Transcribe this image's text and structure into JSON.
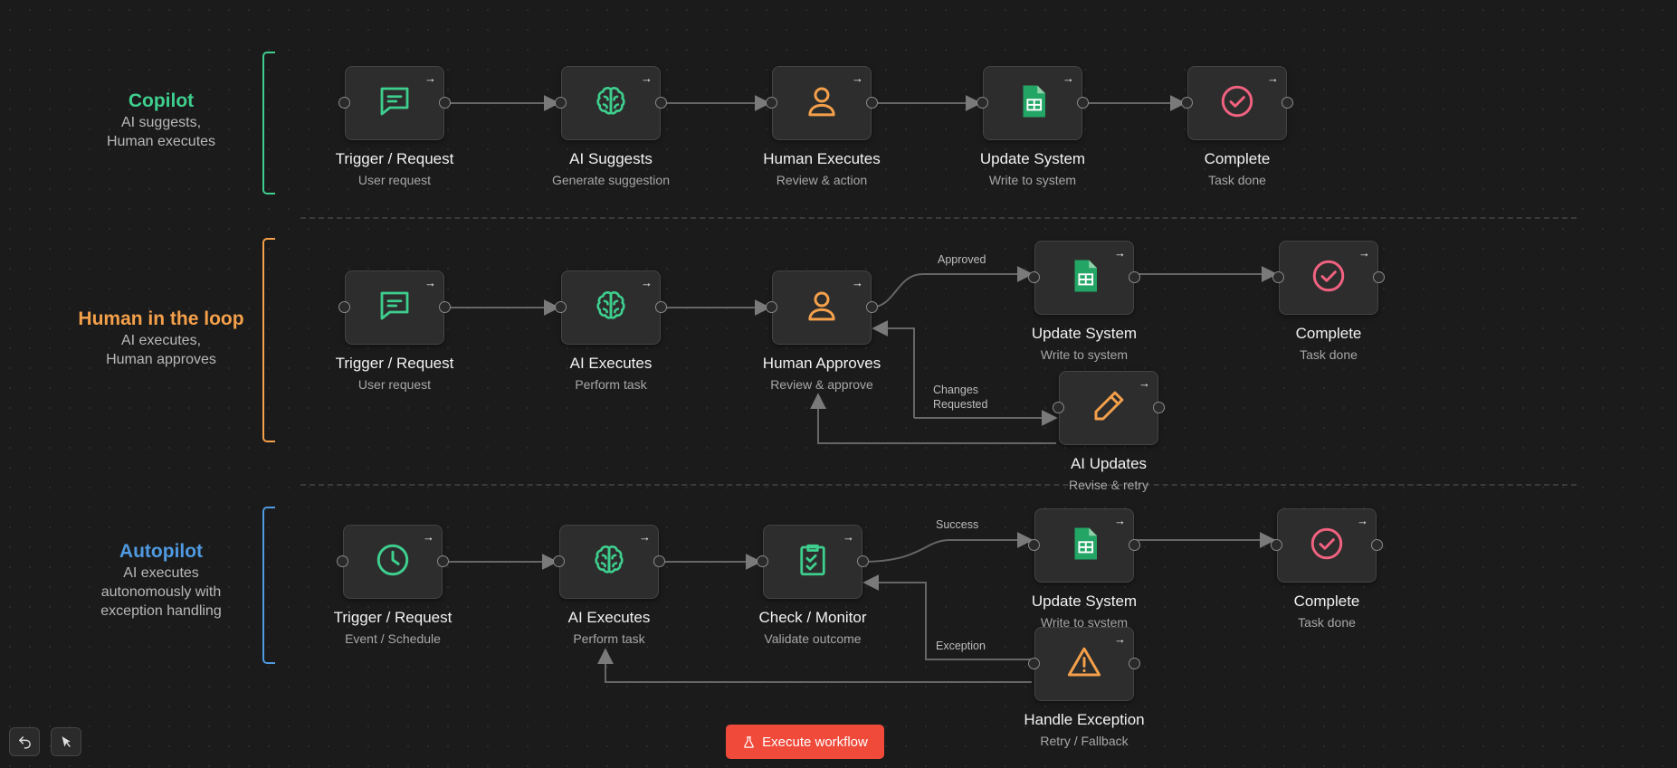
{
  "lanes": [
    {
      "title": "Copilot",
      "desc_line1": "AI suggests,",
      "desc_line2": "Human executes",
      "desc_line3": "",
      "color": "#3ecf8e"
    },
    {
      "title": "Human in the loop",
      "desc_line1": "AI executes,",
      "desc_line2": "Human approves",
      "desc_line3": "",
      "color": "#f5a04a"
    },
    {
      "title": "Autopilot",
      "desc_line1": "AI executes",
      "desc_line2": "autonomously with",
      "desc_line3": "exception handling",
      "color": "#4f9ae0"
    }
  ],
  "nodes": {
    "c1": {
      "title": "Trigger / Request",
      "sub": "User request",
      "icon": "message-icon"
    },
    "c2": {
      "title": "AI Suggests",
      "sub": "Generate suggestion",
      "icon": "brain-icon"
    },
    "c3": {
      "title": "Human Executes",
      "sub": "Review & action",
      "icon": "user-icon"
    },
    "c4": {
      "title": "Update System",
      "sub": "Write to system",
      "icon": "sheets-icon"
    },
    "c5": {
      "title": "Complete",
      "sub": "Task done",
      "icon": "check-circle-icon"
    },
    "h1": {
      "title": "Trigger / Request",
      "sub": "User request",
      "icon": "message-icon"
    },
    "h2": {
      "title": "AI Executes",
      "sub": "Perform task",
      "icon": "brain-icon"
    },
    "h3": {
      "title": "Human Approves",
      "sub": "Review & approve",
      "icon": "user-icon"
    },
    "h4": {
      "title": "Update System",
      "sub": "Write to system",
      "icon": "sheets-icon"
    },
    "h5": {
      "title": "Complete",
      "sub": "Task done",
      "icon": "check-circle-icon"
    },
    "h6": {
      "title": "AI Updates",
      "sub": "Revise & retry",
      "icon": "pencil-icon"
    },
    "a1": {
      "title": "Trigger / Request",
      "sub": "Event / Schedule",
      "icon": "clock-icon"
    },
    "a2": {
      "title": "AI Executes",
      "sub": "Perform task",
      "icon": "brain-icon"
    },
    "a3": {
      "title": "Check / Monitor",
      "sub": "Validate outcome",
      "icon": "checklist-icon"
    },
    "a4": {
      "title": "Update System",
      "sub": "Write to system",
      "icon": "sheets-icon"
    },
    "a5": {
      "title": "Complete",
      "sub": "Task done",
      "icon": "check-circle-icon"
    },
    "a6": {
      "title": "Handle Exception",
      "sub": "Retry / Fallback",
      "icon": "warning-icon"
    }
  },
  "edge_labels": {
    "approved": "Approved",
    "changes_line1": "Changes",
    "changes_line2": "Requested",
    "success": "Success",
    "exception": "Exception"
  },
  "run_arrow": "→",
  "toolbar": {
    "execute_label": "Execute workflow",
    "undo_icon": "undo-icon",
    "select_icon": "pointer-icon"
  },
  "colors": {
    "green": "#3ecf8e",
    "orange": "#f5a04a",
    "pink": "#f0627f",
    "sheets": "#23a566",
    "execute": "#f04a3a"
  }
}
